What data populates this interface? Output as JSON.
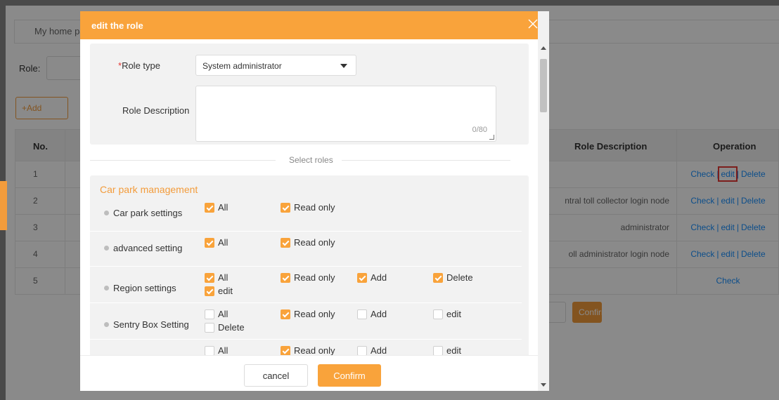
{
  "background": {
    "tab_label": "My home pa",
    "role_filter_label": "Role:",
    "add_button": "+Add",
    "columns": {
      "no": "No.",
      "description": "Role Description",
      "operation": "Operation"
    },
    "rows": [
      {
        "no": "1",
        "description": "",
        "ops": [
          "Check",
          "edit",
          "Delete"
        ]
      },
      {
        "no": "2",
        "description": "ntral toll collector login node",
        "ops": [
          "Check",
          "edit",
          "Delete"
        ]
      },
      {
        "no": "3",
        "description": "administrator",
        "ops": [
          "Check",
          "edit",
          "Delete"
        ]
      },
      {
        "no": "4",
        "description": "oll administrator login node",
        "ops": [
          "Check",
          "edit",
          "Delete"
        ]
      },
      {
        "no": "5",
        "description": "",
        "ops": [
          "Check"
        ]
      }
    ],
    "pager_confirm": "Confirm"
  },
  "modal": {
    "title": "edit the role",
    "role_type": {
      "required_mark": "*",
      "label": "Role type",
      "value": "System administrator"
    },
    "role_description": {
      "label": "Role Description",
      "value": "",
      "counter": "0/80"
    },
    "divider_text": "Select roles",
    "section_title": "Car park management",
    "permissions": [
      {
        "name": "Car park settings",
        "options": [
          {
            "label": "All",
            "checked": true
          },
          {
            "label": "Read only",
            "checked": true
          }
        ]
      },
      {
        "name": "advanced setting",
        "options": [
          {
            "label": "All",
            "checked": true
          },
          {
            "label": "Read only",
            "checked": true
          }
        ]
      },
      {
        "name": "Region settings",
        "options": [
          {
            "label": "All",
            "checked": true
          },
          {
            "label": "Read only",
            "checked": true
          },
          {
            "label": "Add",
            "checked": true
          },
          {
            "label": "Delete",
            "checked": true
          },
          {
            "label": "edit",
            "checked": true
          }
        ]
      },
      {
        "name": "Sentry Box Setting",
        "options": [
          {
            "label": "All",
            "checked": false
          },
          {
            "label": "Read only",
            "checked": true
          },
          {
            "label": "Add",
            "checked": false
          },
          {
            "label": "edit",
            "checked": false
          },
          {
            "label": "Delete",
            "checked": false
          }
        ]
      },
      {
        "name": "",
        "options": [
          {
            "label": "All",
            "checked": false
          },
          {
            "label": "Read only",
            "checked": true
          },
          {
            "label": "Add",
            "checked": false
          },
          {
            "label": "edit",
            "checked": false
          }
        ]
      }
    ],
    "cancel_label": "cancel",
    "confirm_label": "Confirm"
  },
  "colors": {
    "accent": "#f9a33b",
    "link": "#1890ff",
    "highlight": "#e53935"
  }
}
